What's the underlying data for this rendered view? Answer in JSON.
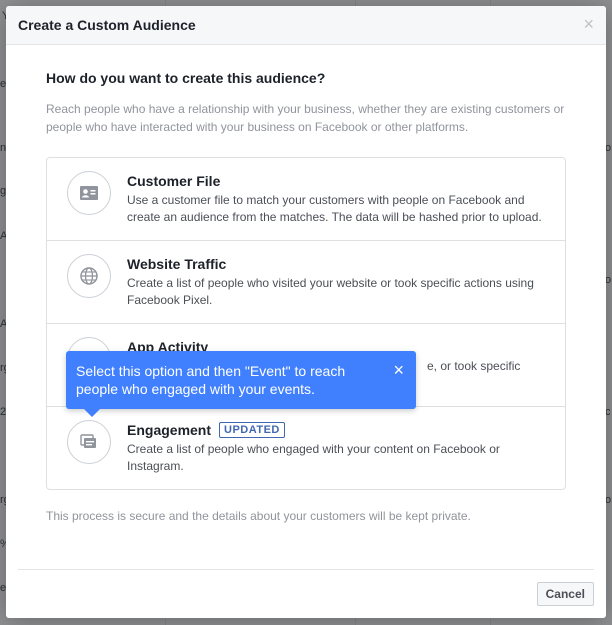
{
  "background": {
    "fragments": [
      "Y",
      "e",
      "ni",
      "ge",
      "A",
      "A",
      "rg",
      "2",
      "rg",
      "%",
      "e",
      "o",
      "o",
      "c",
      "o"
    ]
  },
  "modal": {
    "title": "Create a Custom Audience",
    "close_glyph": "×",
    "question": "How do you want to create this audience?",
    "intro": "Reach people who have a relationship with your business, whether they are existing customers or people who have interacted with your business on Facebook or other platforms.",
    "options": [
      {
        "title": "Customer File",
        "description": "Use a customer file to match your customers with people on Facebook and create an audience from the matches. The data will be hashed prior to upload.",
        "icon": "contact-card-icon"
      },
      {
        "title": "Website Traffic",
        "description": "Create a list of people who visited your website or took specific actions using Facebook Pixel.",
        "icon": "globe-icon"
      },
      {
        "title": "App Activity",
        "description": "e, or took specific",
        "icon": "app-icon"
      },
      {
        "title": "Engagement",
        "badge": "UPDATED",
        "description": "Create a list of people who engaged with your content on Facebook or Instagram.",
        "icon": "engagement-icon"
      }
    ],
    "tooltip": {
      "text": "Select this option and then \"Event\" to reach people who engaged with your events.",
      "close_glyph": "×"
    },
    "footer_note": "This process is secure and the details about your customers will be kept private.",
    "cancel_label": "Cancel"
  },
  "colors": {
    "tooltip_blue": "#4080ff",
    "badge_blue": "#4267b2"
  }
}
